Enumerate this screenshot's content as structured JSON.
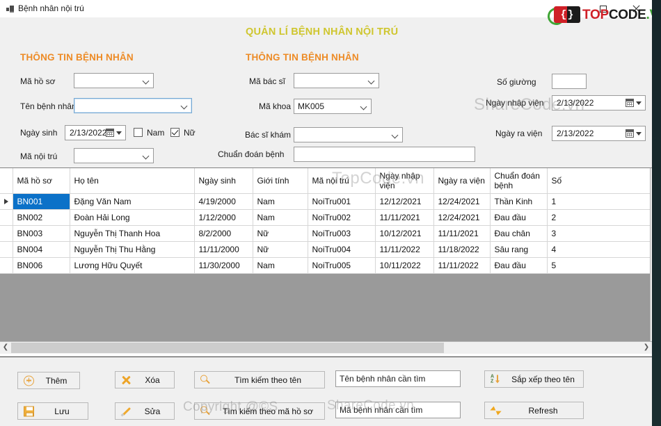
{
  "window": {
    "title": "Bệnh nhân nội trú",
    "icon": "app-icon",
    "controls": {
      "minimize": "–",
      "maximize": "☐",
      "close": "✕"
    }
  },
  "logo": {
    "bracket_left": "{",
    "bracket_right": "}",
    "top": "TOP",
    "code": "CODE",
    "dot_vn": ".VN"
  },
  "headings": {
    "main_title": "QUẢN LÍ BỆNH NHÂN NỘI TRÚ",
    "section_left": "THÔNG TIN BỆNH NHÂN",
    "section_mid": "THÔNG TIN BỆNH NHÂN"
  },
  "colors": {
    "main_title": "#cfc62f",
    "section_title": "#ed8b26",
    "selection": "#0b71c8",
    "icon_accent": "#e8a33d",
    "form_bg": "#f0f0f0"
  },
  "form": {
    "left": {
      "ma_ho_so": {
        "label": "Mã hồ sơ",
        "value": ""
      },
      "ten_benh_nhan": {
        "label": "Tên bệnh nhân",
        "value": ""
      },
      "ngay_sinh": {
        "label": "Ngày sinh",
        "value": "2/13/2022"
      },
      "gender_nam": {
        "label": "Nam",
        "checked": false
      },
      "gender_nu": {
        "label": "Nữ",
        "checked": true
      },
      "ma_noi_tru": {
        "label": "Mã nội trú",
        "value": ""
      }
    },
    "middle": {
      "ma_bac_si": {
        "label": "Mã bác sĩ",
        "value": ""
      },
      "ma_khoa": {
        "label": "Mã khoa",
        "value": "MK005"
      },
      "bac_si_kham": {
        "label": "Bác sĩ khám",
        "value": ""
      },
      "chuan_doan_benh": {
        "label": "Chuẩn đoán bệnh",
        "value": ""
      }
    },
    "right": {
      "so_giuong": {
        "label": "Số giường",
        "value": ""
      },
      "ngay_nhap_vien": {
        "label": "Ngày nhập viện",
        "value": "2/13/2022"
      },
      "ngay_ra_vien": {
        "label": "Ngày ra viện",
        "value": "2/13/2022"
      }
    }
  },
  "grid": {
    "columns": [
      "Mã hồ sơ",
      "Họ tên",
      "Ngày sinh",
      "Giới tính",
      "Mã nội trú",
      "Ngày nhập viện",
      "Ngày ra viện",
      "Chuẩn đoán bệnh",
      "Số"
    ],
    "rows": [
      {
        "selected": true,
        "marker": true,
        "cells": [
          "BN001",
          "Đặng Văn Nam",
          "4/19/2000",
          "Nam",
          "NoiTru001",
          "12/12/2021",
          "12/24/2021",
          "Thần Kinh",
          "1"
        ]
      },
      {
        "selected": false,
        "marker": false,
        "cells": [
          "BN002",
          "Đoàn Hải Long",
          "1/12/2000",
          "Nam",
          "NoiTru002",
          "11/11/2021",
          "12/24/2021",
          "Đau đầu",
          "2"
        ]
      },
      {
        "selected": false,
        "marker": false,
        "cells": [
          "BN003",
          "Nguyễn Thị Thanh Hoa",
          "8/2/2000",
          "Nữ",
          "NoiTru003",
          "10/12/2021",
          "11/11/2021",
          "Đau chân",
          "3"
        ]
      },
      {
        "selected": false,
        "marker": false,
        "cells": [
          "BN004",
          "Nguyễn Thị Thu Hằng",
          "11/11/2000",
          "Nữ",
          "NoiTru004",
          "11/11/2022",
          "11/18/2022",
          "Sâu rang",
          "4"
        ]
      },
      {
        "selected": false,
        "marker": false,
        "cells": [
          "BN006",
          "Lương Hữu Quyết",
          "11/30/2000",
          "Nam",
          "NoiTru005",
          "10/11/2022",
          "11/11/2022",
          "Đau đầu",
          "5"
        ]
      }
    ]
  },
  "actions": {
    "them": "Thêm",
    "xoa": "Xóa",
    "tim_theo_ten": "Tìm kiếm theo tên",
    "sap_xep": "Sắp xếp theo tên",
    "luu": "Lưu",
    "sua": "Sửa",
    "tim_theo_ma": "Tìm kiếm theo mã hồ sơ",
    "refresh": "Refresh"
  },
  "search": {
    "ten_benh_nhan": {
      "value": "Tên bệnh nhân cần tìm",
      "placeholder": "Tên bệnh nhân cần tìm"
    },
    "ma_benh_nhan": {
      "value": "Mã bệnh nhân cần tìm",
      "placeholder": "Mã bệnh nhân cần tìm"
    }
  },
  "watermarks": {
    "sharecode_form": "ShareCode.vn",
    "topcode_grid": "TopCode.vn",
    "copyright": "Copyright @©S",
    "sharecode_bottom": "ShareCode.vn"
  }
}
